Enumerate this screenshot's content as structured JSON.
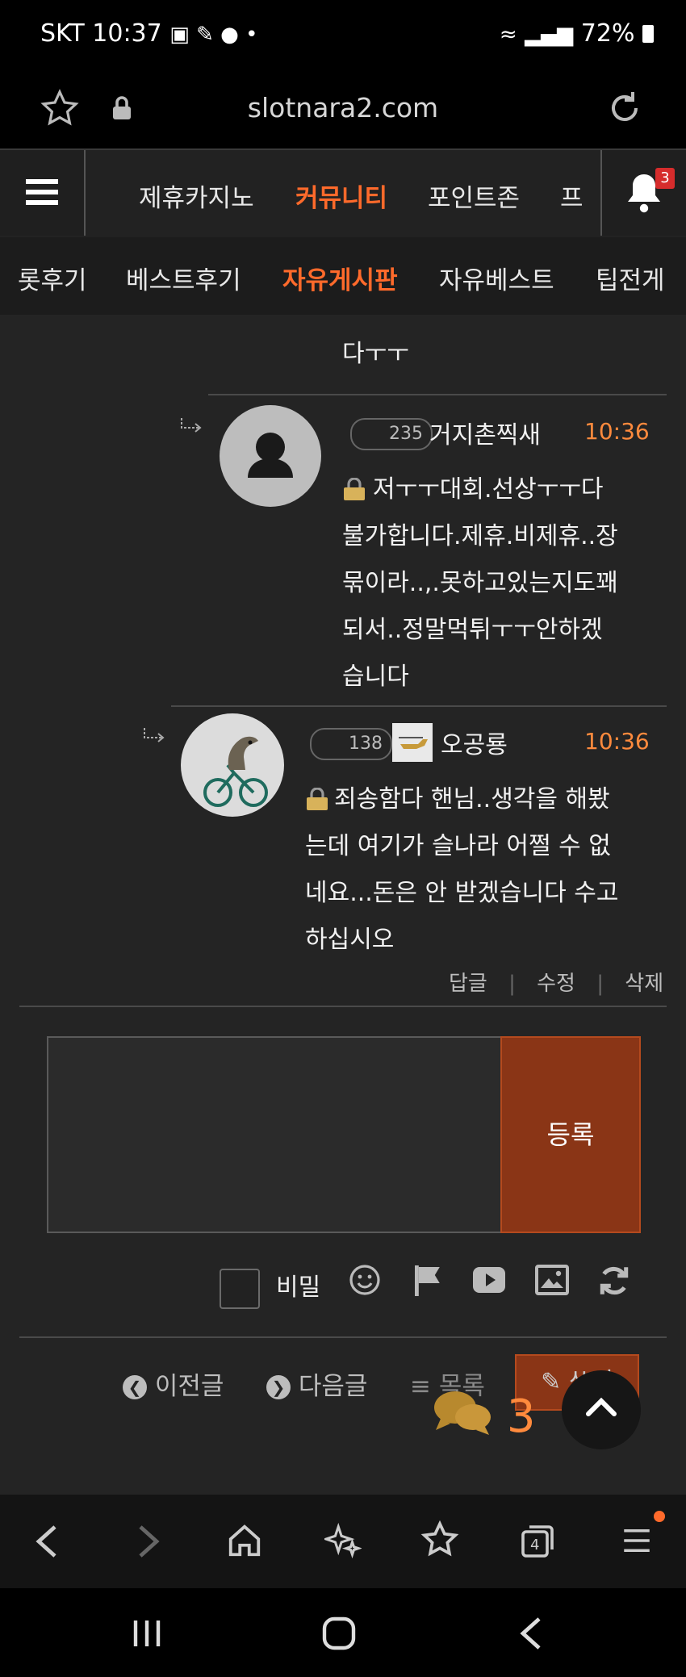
{
  "status": {
    "carrier": "SKT",
    "time": "10:37",
    "battery": "72%"
  },
  "browser": {
    "url": "slotnara2.com"
  },
  "nav": {
    "tabs": [
      {
        "label": "제휴카지노"
      },
      {
        "label": "커뮤니티"
      },
      {
        "label": "포인트존"
      },
      {
        "label": "프"
      }
    ],
    "notification_count": "3"
  },
  "subnav": {
    "tabs": [
      {
        "label": "롯후기"
      },
      {
        "label": "베스트후기"
      },
      {
        "label": "자유게시판"
      },
      {
        "label": "자유베스트"
      },
      {
        "label": "팁전게"
      }
    ]
  },
  "comments": [
    {
      "text_tail": "다ㅜㅜ"
    },
    {
      "level": "235",
      "nick": "거지촌찍새",
      "time": "10:36",
      "lines": [
        "저ㅜㅜ대회.선상ㅜㅜ다",
        "불가합니다.제휴.비제휴..장",
        "묶이라..,.못하고있는지도꽤",
        "되서..정말먹튀ㅜㅜ안하겠",
        "습니다"
      ]
    },
    {
      "level": "138",
      "nick": "오공룡",
      "time": "10:36",
      "lines": [
        "죄송함다 핸님..생각을 해봤",
        "는데 여기가 슬나라 어쩔 수 없",
        "네요...돈은 안 받겠습니다 수고",
        "하십시오"
      ],
      "actions": {
        "reply": "답글",
        "edit": "수정",
        "delete": "삭제"
      }
    }
  ],
  "form": {
    "submit": "등록",
    "secret_label": "비밀"
  },
  "bottom_actions": {
    "prev": "이전글",
    "next": "다음글",
    "list": "목록",
    "write": "쓰기",
    "comment_count": "3"
  },
  "colors": {
    "accent": "#ff6a2b",
    "submit_bg": "#8a3516",
    "time": "#ff8a3d"
  }
}
